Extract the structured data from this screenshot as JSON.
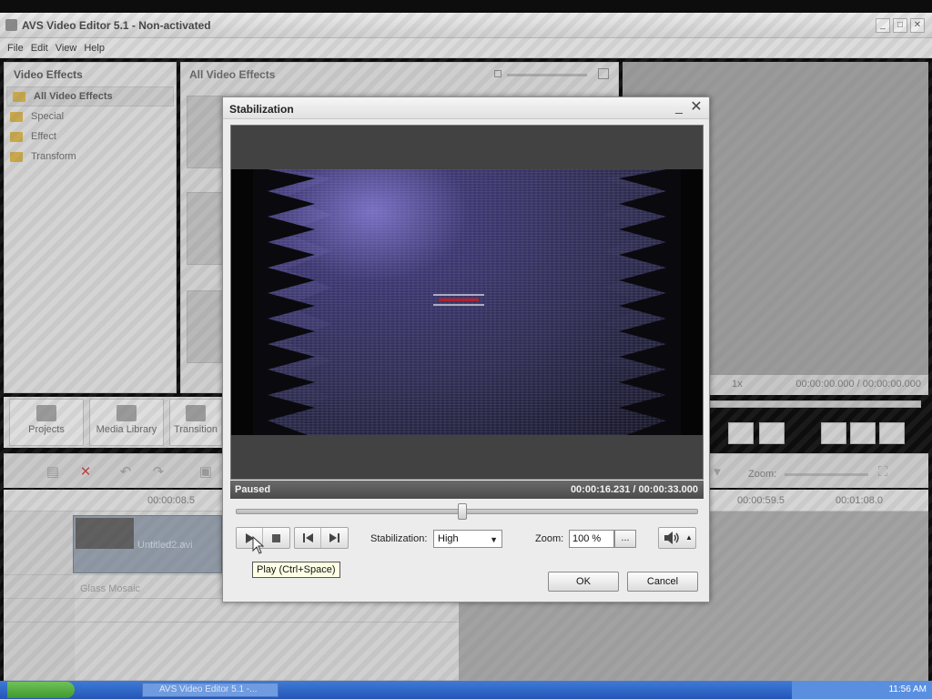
{
  "app": {
    "title": "AVS Video Editor 5.1 - Non-activated",
    "window_buttons": [
      "_",
      "□",
      "✕"
    ],
    "menu": [
      "File",
      "Edit",
      "View",
      "Help"
    ]
  },
  "left_panel": {
    "title": "Video Effects",
    "items": [
      {
        "label": "All Video Effects",
        "selected": true
      },
      {
        "label": "Special",
        "selected": false
      },
      {
        "label": "Effect",
        "selected": false
      },
      {
        "label": "Transform",
        "selected": false
      }
    ]
  },
  "center_panel": {
    "title": "All Video Effects"
  },
  "preview": {
    "speed": "1x",
    "timecode": "00:00:00.000 / 00:00:00.000"
  },
  "big_toolbar": {
    "buttons": [
      {
        "label": "Projects",
        "icon": "projects-icon"
      },
      {
        "label": "Media Library",
        "icon": "media-library-icon"
      },
      {
        "label": "Transition",
        "icon": "transitions-icon"
      }
    ]
  },
  "timeline": {
    "zoom_label": "Zoom:",
    "ruler_labels": [
      "00:00:08.5",
      "00:00:59.5",
      "00:01:08.0"
    ],
    "clip_name": "Untitled2.avi",
    "effect_track_label": "Glass Mosaic"
  },
  "taskbar": {
    "task_label": "AVS Video Editor 5.1 -...",
    "clock": "11:56 AM"
  },
  "dialog": {
    "title": "Stabilization",
    "status": "Paused",
    "timecode": "00:00:16.231  /  00:00:33.000",
    "seek_position_fraction": 0.49,
    "stabilization_label": "Stabilization:",
    "stabilization_value": "High",
    "zoom_label": "Zoom:",
    "zoom_value": "100 %",
    "zoom_more_label": "...",
    "tooltip": "Play (Ctrl+Space)",
    "ok_label": "OK",
    "cancel_label": "Cancel",
    "colors": {
      "status_bar": "#555555",
      "tooltip_bg": "#ffffe6"
    }
  }
}
